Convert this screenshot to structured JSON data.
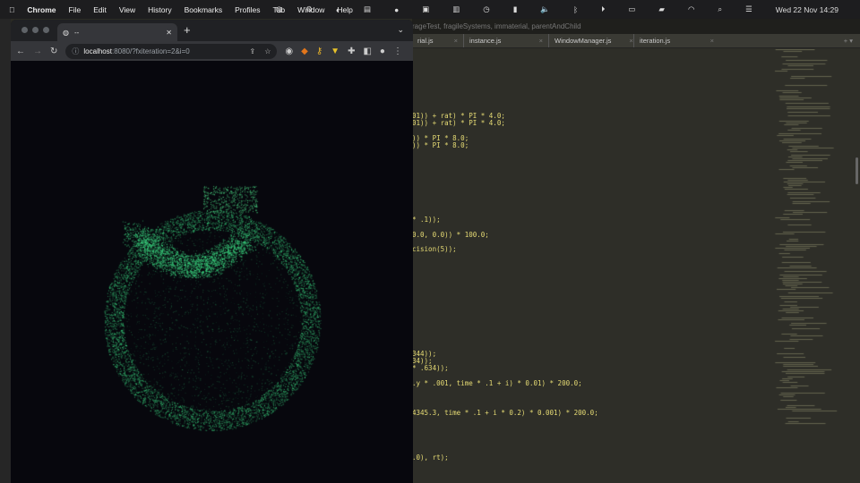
{
  "menubar": {
    "app": "Chrome",
    "items": [
      "File",
      "Edit",
      "View",
      "History",
      "Bookmarks",
      "Profiles",
      "Tab",
      "Window",
      "Help"
    ],
    "datetime": "Wed 22 Nov  14:29"
  },
  "browser": {
    "tab_title": "--",
    "url_host": "localhost",
    "url_rest": ":8080/?fxiteration=2&i=0"
  },
  "editor": {
    "title": "rageTest, fragileSystems, immaterial, parentAndChild",
    "tabs": [
      "rial.js",
      "instance.js",
      "WindowManager.js",
      "iteration.js"
    ],
    "code_lines": [
      "01)) + rat) * PI * 4.0;",
      "01)) + rat) * PI * 4.0;",
      "",
      ")) * PI * 8.0;",
      ")) * PI * 8.0;",
      "",
      "",
      "",
      "",
      "",
      "",
      "",
      "",
      "",
      "* .1));",
      "",
      "0.0, 0.0)) * 100.0;",
      "",
      "cision(5));",
      "",
      "",
      "",
      "",
      "",
      "",
      "",
      "",
      "",
      "",
      "",
      "",
      "",
      "344));",
      "34));",
      "* .634));",
      "",
      ".y * .001, time * .1 + i) * 0.01) * 200.0;",
      "",
      "",
      "",
      "4345.3, time * .1 + i * 0.2) * 0.001) * 200.0;",
      "",
      "",
      "",
      "",
      "",
      ".0), rt);"
    ]
  },
  "colors": {
    "particles": "#3ddc84",
    "code": "#e6db74",
    "editor_bg": "#2e2e28"
  }
}
